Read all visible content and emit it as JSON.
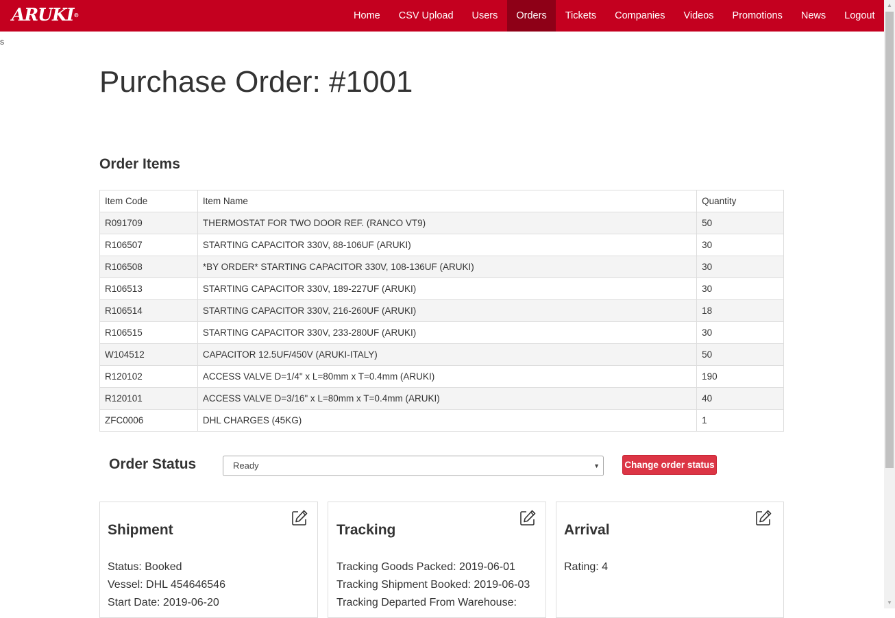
{
  "navbar": {
    "brand": "ARUKI",
    "brand_mark": "®",
    "items": [
      {
        "label": "Home"
      },
      {
        "label": "CSV Upload"
      },
      {
        "label": "Users"
      },
      {
        "label": "Orders"
      },
      {
        "label": "Tickets"
      },
      {
        "label": "Companies"
      },
      {
        "label": "Videos"
      },
      {
        "label": "Promotions"
      },
      {
        "label": "News"
      },
      {
        "label": "Logout"
      }
    ],
    "active": "Orders",
    "color": "#c4001f",
    "active_color": "#8e0017"
  },
  "stray_text": "s",
  "page_title": "Purchase Order: #1001",
  "order_items": {
    "title": "Order Items",
    "headers": {
      "code": "Item Code",
      "name": "Item Name",
      "quantity": "Quantity"
    },
    "rows": [
      {
        "code": "R091709",
        "name": "THERMOSTAT FOR TWO DOOR REF. (RANCO VT9)",
        "quantity": "50"
      },
      {
        "code": "R106507",
        "name": "STARTING CAPACITOR 330V, 88-106UF (ARUKI)",
        "quantity": "30"
      },
      {
        "code": "R106508",
        "name": "*BY ORDER* STARTING CAPACITOR 330V, 108-136UF (ARUKI)",
        "quantity": "30"
      },
      {
        "code": "R106513",
        "name": "STARTING CAPACITOR 330V, 189-227UF (ARUKI)",
        "quantity": "30"
      },
      {
        "code": "R106514",
        "name": "STARTING CAPACITOR 330V, 216-260UF (ARUKI)",
        "quantity": "18"
      },
      {
        "code": "R106515",
        "name": "STARTING CAPACITOR 330V, 233-280UF (ARUKI)",
        "quantity": "30"
      },
      {
        "code": "W104512",
        "name": "CAPACITOR 12.5UF/450V (ARUKI-ITALY)",
        "quantity": "50"
      },
      {
        "code": "R120102",
        "name": "ACCESS VALVE D=1/4\" x L=80mm x T=0.4mm (ARUKI)",
        "quantity": "190"
      },
      {
        "code": "R120101",
        "name": "ACCESS VALVE D=3/16\" x L=80mm x T=0.4mm (ARUKI)",
        "quantity": "40"
      },
      {
        "code": "ZFC0006",
        "name": "DHL CHARGES (45KG)",
        "quantity": "1"
      }
    ]
  },
  "order_status": {
    "label": "Order Status",
    "selected": "Ready",
    "button_label": "Change order status",
    "button_color": "#dc3545"
  },
  "cards": {
    "shipment": {
      "title": "Shipment",
      "lines": [
        "Status: Booked",
        "Vessel: DHL 454646546",
        "Start Date: 2019-06-20"
      ]
    },
    "tracking": {
      "title": "Tracking",
      "lines": [
        "Tracking Goods Packed: 2019-06-01",
        "Tracking Shipment Booked: 2019-06-03",
        "Tracking Departed From Warehouse:"
      ]
    },
    "arrival": {
      "title": "Arrival",
      "lines": [
        "Rating: 4"
      ]
    }
  },
  "icons": {
    "edit": "edit-icon",
    "select_arrow": "chevron-down-icon"
  }
}
